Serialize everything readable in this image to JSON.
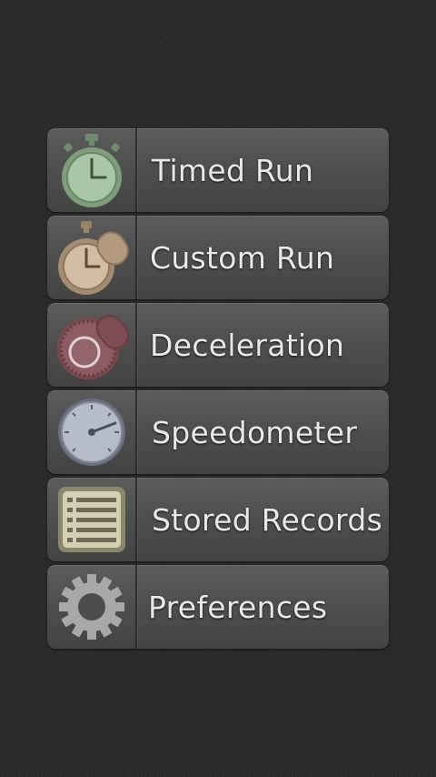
{
  "menu": {
    "items": [
      {
        "label": "Timed Run",
        "icon": "stopwatch-icon"
      },
      {
        "label": "Custom Run",
        "icon": "custom-stopwatch-icon"
      },
      {
        "label": "Deceleration",
        "icon": "deceleration-dial-icon"
      },
      {
        "label": "Speedometer",
        "icon": "speedometer-icon"
      },
      {
        "label": "Stored Records",
        "icon": "records-list-icon"
      },
      {
        "label": "Preferences",
        "icon": "gear-icon"
      }
    ]
  },
  "colors": {
    "background": "#2b2b2b",
    "button": "#4f4f4f",
    "text": "#e8e8e8",
    "timed_icon": "#8fae8c",
    "custom_icon": "#b09a80",
    "decel_icon": "#8a5a5e",
    "speed_icon": "#a9b0bd",
    "records_icon": "#c8c4a8",
    "gear_icon": "#a8a8a8"
  }
}
